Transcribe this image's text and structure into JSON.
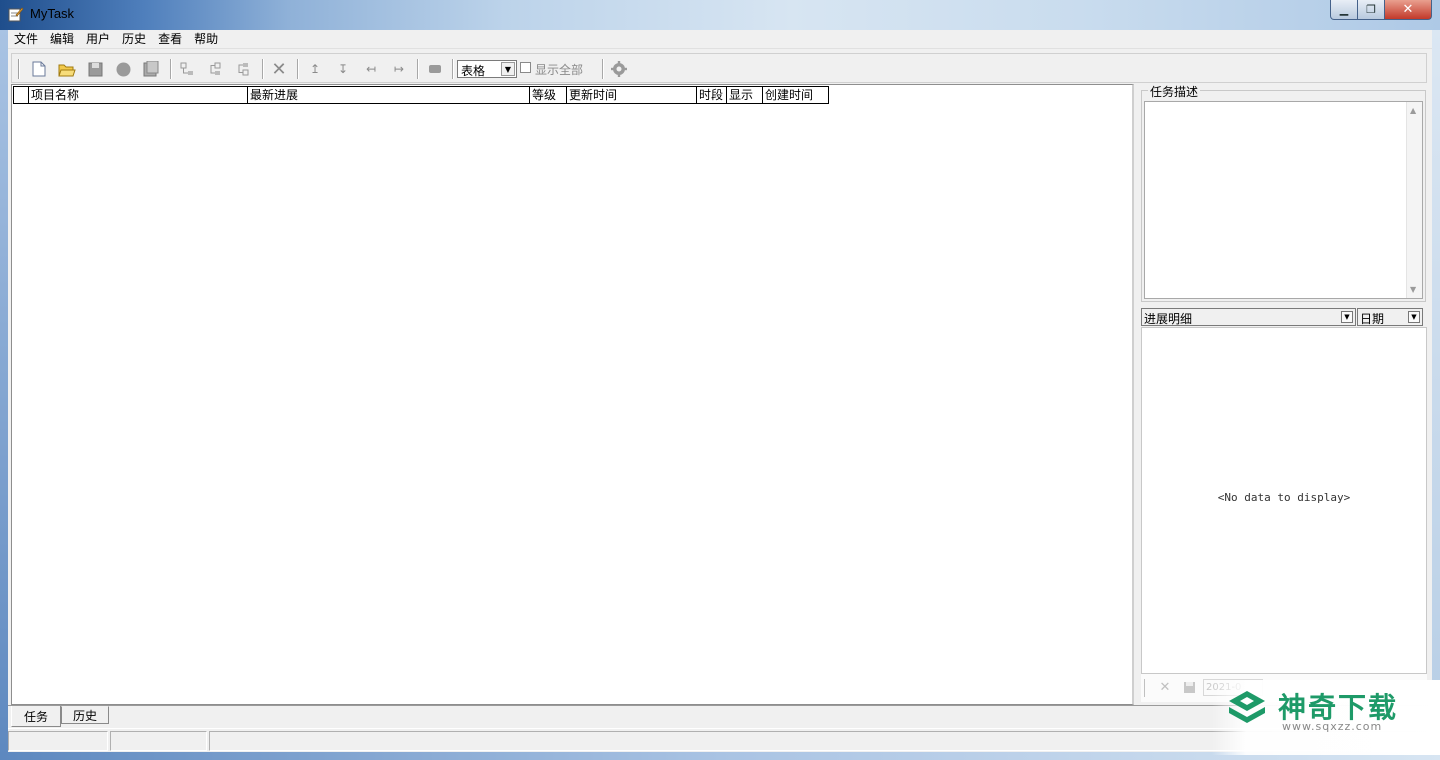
{
  "window": {
    "title": "MyTask",
    "min_glyph": "▁",
    "max_glyph": "❐",
    "close_glyph": "✕"
  },
  "menu": [
    "文件",
    "编辑",
    "用户",
    "历史",
    "查看",
    "帮助"
  ],
  "toolbar": {
    "view_select_value": "表格",
    "show_all_label": "显示全部",
    "show_all_checked": false
  },
  "grid": {
    "columns": [
      "",
      "项目名称",
      "最新进展",
      "等级",
      "更新时间",
      "时段",
      "显示",
      "创建时间"
    ],
    "rows": []
  },
  "right_panel": {
    "description_title": "任务描述",
    "description_text": "",
    "detail_combo": "进展明细",
    "date_combo": "日期",
    "no_data_text": "<No data to display>",
    "detail_date": "2021-0"
  },
  "tabs": [
    {
      "label": "任务",
      "active": true
    },
    {
      "label": "历史",
      "active": false
    }
  ],
  "watermark": {
    "text": "神奇下载",
    "url": "www.sqxzz.com",
    "color": "#1e9a68"
  }
}
